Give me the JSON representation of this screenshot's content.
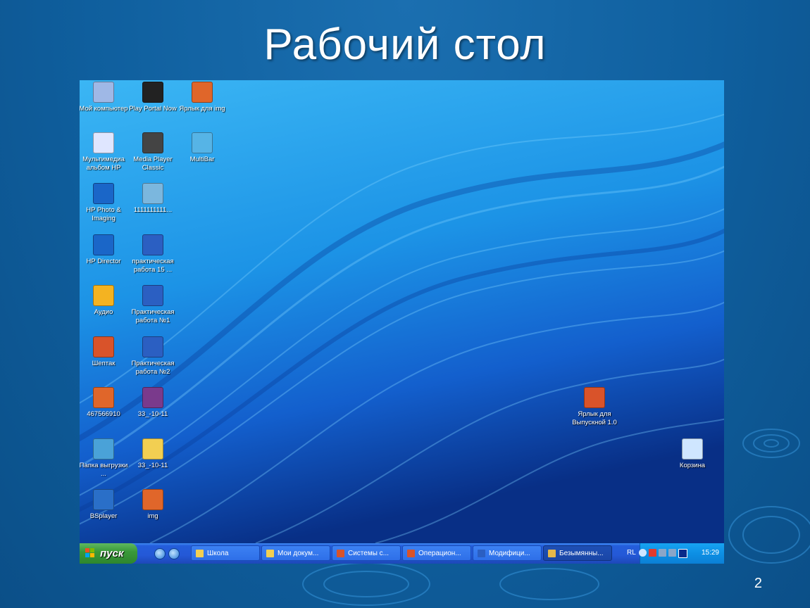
{
  "slide": {
    "title": "Рабочий стол",
    "page_number": "2"
  },
  "desktop": {
    "icons": [
      {
        "label": "Мой компьютер",
        "icon": "my-computer-icon",
        "color": "#9fb8e6"
      },
      {
        "label": "Play Portal Now",
        "icon": "play-portal-icon",
        "color": "#222222"
      },
      {
        "label": "Ярлык для img",
        "icon": "image-shortcut-icon",
        "color": "#e0662a"
      },
      {
        "label": "Мультимедиа альбом HP",
        "icon": "hp-album-icon",
        "color": "#dfe6ff"
      },
      {
        "label": "Media Player Classic",
        "icon": "media-player-classic-icon",
        "color": "#444444"
      },
      {
        "label": "MultiBar",
        "icon": "multibar-icon",
        "color": "#56b4e6"
      },
      {
        "label": "HP Photo & Imaging",
        "icon": "hp-photo-icon",
        "color": "#1a66c8"
      },
      {
        "label": "1111111111...",
        "icon": "disk-drive-icon",
        "color": "#7bb7de"
      },
      {
        "label": "HP Director",
        "icon": "hp-director-icon",
        "color": "#1a66c8"
      },
      {
        "label": "практическая работа 15 ...",
        "icon": "word-document-icon",
        "color": "#2b5fc2"
      },
      {
        "label": "Аудио",
        "icon": "audio-player-icon",
        "color": "#f4b321"
      },
      {
        "label": "Практическая работа №1",
        "icon": "word-document-icon",
        "color": "#2b5fc2"
      },
      {
        "label": "Шептак",
        "icon": "powerpoint-document-icon",
        "color": "#d9532a"
      },
      {
        "label": "Практическая работа №2",
        "icon": "word-document-icon",
        "color": "#2b5fc2"
      },
      {
        "label": "467566910",
        "icon": "image-file-icon",
        "color": "#e0662a"
      },
      {
        "label": "33_-10-11",
        "icon": "winrar-archive-icon",
        "color": "#7a3a8c"
      },
      {
        "label": "Папка выгрузки ...",
        "icon": "hp-folder-icon",
        "color": "#4aa2d8"
      },
      {
        "label": "33_-10-11",
        "icon": "folder-icon",
        "color": "#f2cf52"
      },
      {
        "label": "BSplayer",
        "icon": "bsplayer-icon",
        "color": "#2a6fc8"
      },
      {
        "label": "img",
        "icon": "image-file-icon",
        "color": "#e0662a"
      },
      {
        "label": "Ярлык для Выпускной 1.0",
        "icon": "powerpoint-shortcut-icon",
        "color": "#d9532a"
      },
      {
        "label": "Корзина",
        "icon": "recycle-bin-icon",
        "color": "#cfe6ff"
      }
    ]
  },
  "taskbar": {
    "start_label": "пуск",
    "tasks": [
      {
        "label": "Школа",
        "icon": "folder-icon",
        "color": "#f2cf52"
      },
      {
        "label": "Мои докум...",
        "icon": "folder-icon",
        "color": "#f2cf52"
      },
      {
        "label": "Системы с...",
        "icon": "powerpoint-icon",
        "color": "#d9532a"
      },
      {
        "label": "Операцион...",
        "icon": "powerpoint-icon",
        "color": "#d9532a"
      },
      {
        "label": "Модифици...",
        "icon": "word-icon",
        "color": "#2b5fc2"
      },
      {
        "label": "Безымянны...",
        "icon": "paint-icon",
        "color": "#e6b84a"
      }
    ],
    "tray": {
      "language": "RL",
      "clock": "15:29"
    }
  }
}
